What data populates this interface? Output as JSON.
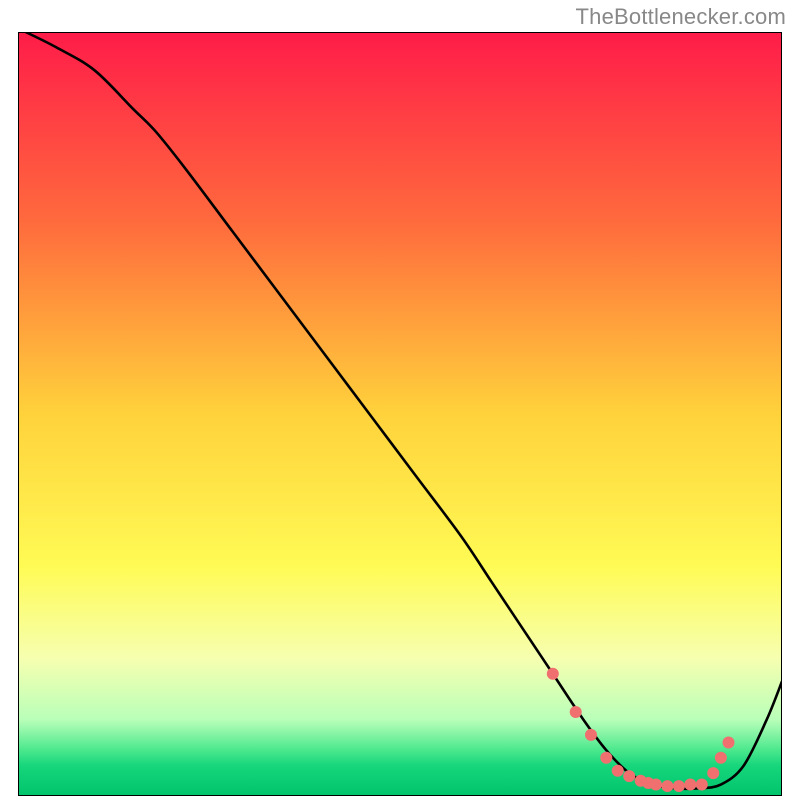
{
  "attribution": "TheBottlenecker.com",
  "chart_data": {
    "type": "line",
    "title": "",
    "xlabel": "",
    "ylabel": "",
    "xlim": [
      0,
      100
    ],
    "ylim": [
      0,
      100
    ],
    "gradient_stops": [
      {
        "pct": 0,
        "color": "#ff1c49"
      },
      {
        "pct": 25,
        "color": "#ff6b3d"
      },
      {
        "pct": 50,
        "color": "#ffd23b"
      },
      {
        "pct": 70,
        "color": "#fffb55"
      },
      {
        "pct": 82,
        "color": "#f6ffb0"
      },
      {
        "pct": 90,
        "color": "#b9ffb9"
      },
      {
        "pct": 94,
        "color": "#4be88d"
      },
      {
        "pct": 96,
        "color": "#17d67c"
      },
      {
        "pct": 100,
        "color": "#00c46b"
      }
    ],
    "series": [
      {
        "name": "bottleneck-curve",
        "color": "#000000",
        "x": [
          1,
          5,
          10,
          15,
          18,
          22,
          28,
          34,
          40,
          46,
          52,
          58,
          62,
          66,
          70,
          74,
          77,
          80,
          83,
          86,
          89,
          92,
          95,
          98,
          100
        ],
        "y": [
          100,
          98,
          95,
          90,
          87,
          82,
          74,
          66,
          58,
          50,
          42,
          34,
          28,
          22,
          16,
          10,
          6,
          3,
          1.5,
          1,
          1,
          1.5,
          4,
          10,
          15
        ]
      }
    ],
    "markers": {
      "name": "minimum-band",
      "color": "#f07070",
      "radius": 6,
      "points": [
        {
          "x": 70,
          "y": 16
        },
        {
          "x": 73,
          "y": 11
        },
        {
          "x": 75,
          "y": 8
        },
        {
          "x": 77,
          "y": 5
        },
        {
          "x": 78.5,
          "y": 3.3
        },
        {
          "x": 80,
          "y": 2.6
        },
        {
          "x": 81.5,
          "y": 2.0
        },
        {
          "x": 82.5,
          "y": 1.7
        },
        {
          "x": 83.5,
          "y": 1.5
        },
        {
          "x": 85,
          "y": 1.3
        },
        {
          "x": 86.5,
          "y": 1.3
        },
        {
          "x": 88,
          "y": 1.5
        },
        {
          "x": 89.5,
          "y": 1.5
        },
        {
          "x": 91,
          "y": 3
        },
        {
          "x": 92,
          "y": 5
        },
        {
          "x": 93,
          "y": 7
        }
      ]
    }
  }
}
